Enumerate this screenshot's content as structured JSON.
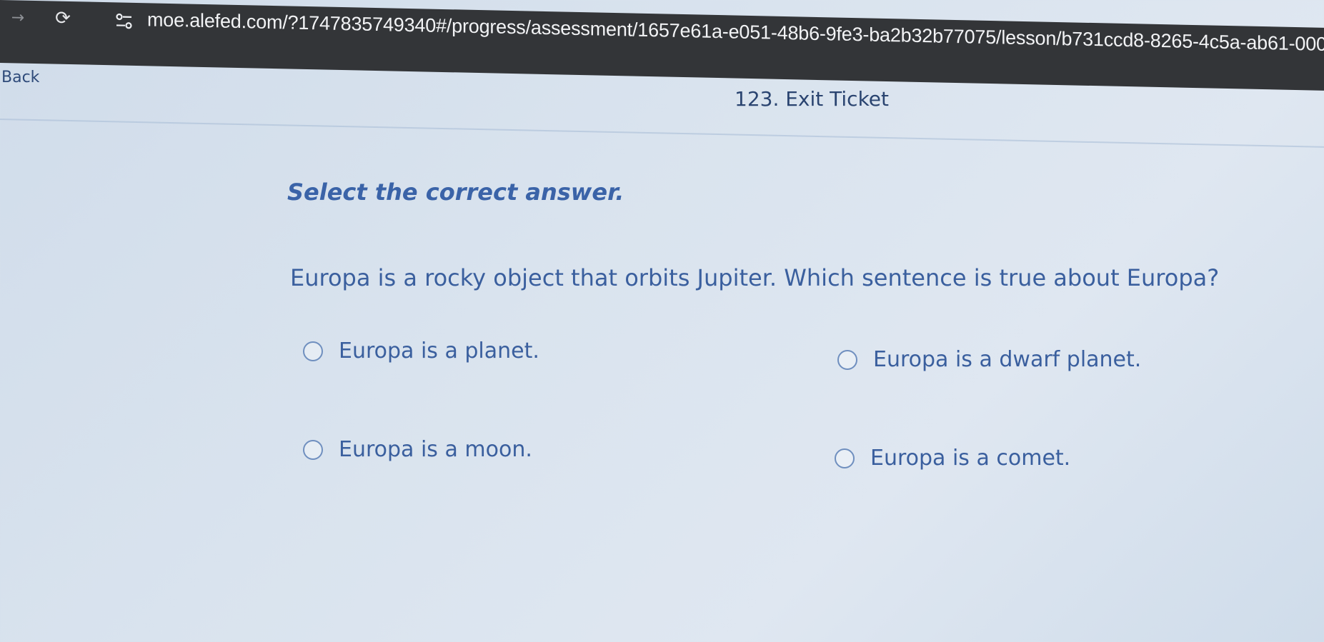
{
  "browser": {
    "url": "moe.alefed.com/?1747835749340#/progress/assessment/1657e61a-e051-48b6-9fe3-ba2b32b77075/lesson/b731ccd8-8265-4c5a-ab61-000000066..."
  },
  "header": {
    "back_label": "Back",
    "title": "123. Exit Ticket"
  },
  "question": {
    "instruction": "Select the correct answer.",
    "prompt": "Europa is a rocky object that orbits Jupiter. Which sentence is true about Europa?",
    "options": [
      {
        "label": "Europa is a planet."
      },
      {
        "label": "Europa is a dwarf planet."
      },
      {
        "label": "Europa is a moon."
      },
      {
        "label": "Europa is a comet."
      }
    ]
  },
  "colors": {
    "browser_bar": "#333538",
    "accent_text": "#3a63a8",
    "page_background": "#d9e3ee"
  }
}
